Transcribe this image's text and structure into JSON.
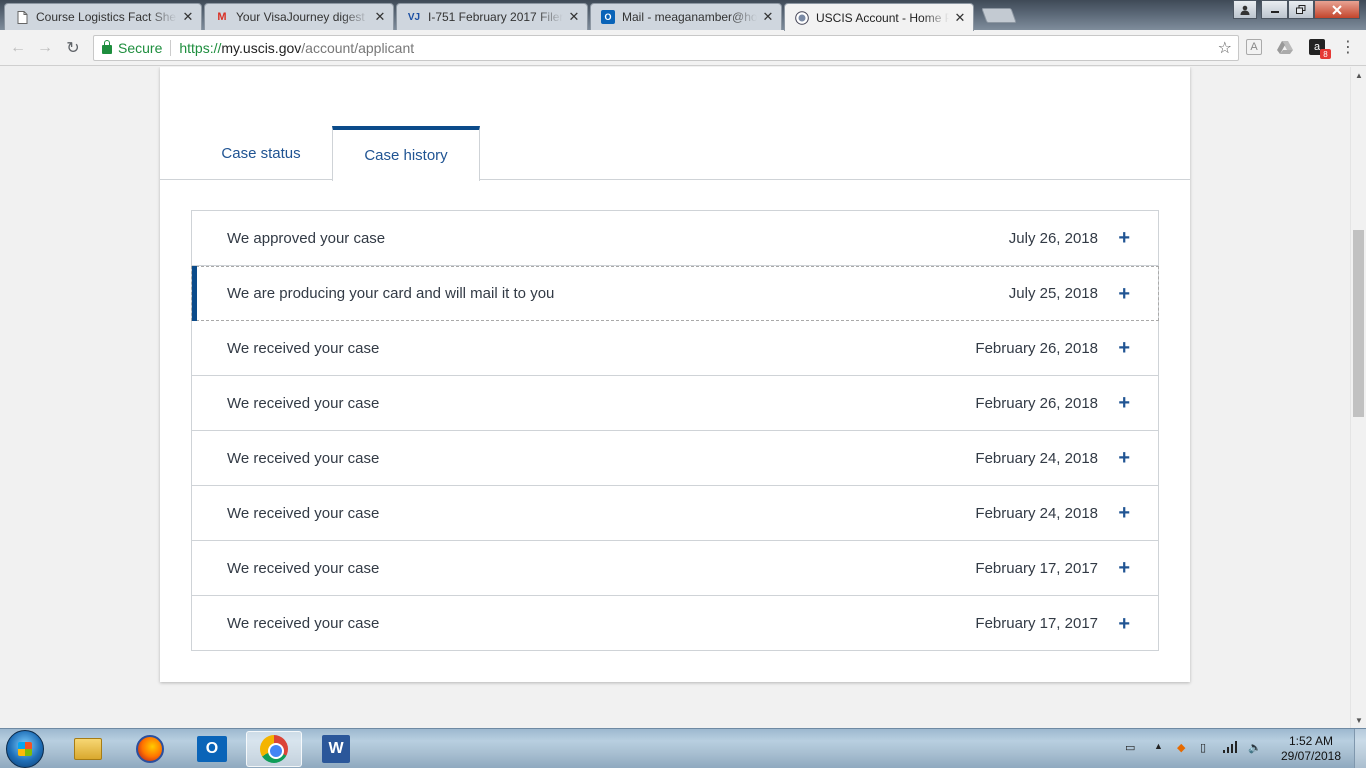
{
  "browser": {
    "tabs": [
      {
        "title": "Course Logistics Fact She",
        "favicon": "document-icon",
        "active": false
      },
      {
        "title": "Your VisaJourney digest -",
        "favicon": "gmail-icon",
        "active": false
      },
      {
        "title": "I-751 February 2017 Filer",
        "favicon": "visajourney-icon",
        "active": false
      },
      {
        "title": "Mail - meaganamber@ho",
        "favicon": "outlook-icon",
        "active": false
      },
      {
        "title": "USCIS Account - Home P",
        "favicon": "uscis-seal-icon",
        "active": true
      }
    ],
    "secure_label": "Secure",
    "url_scheme": "https://",
    "url_host": "my.uscis.gov",
    "url_path": "/account/applicant",
    "extension_badge": "8"
  },
  "page": {
    "case_tabs": [
      {
        "label": "Case status",
        "active": false
      },
      {
        "label": "Case history",
        "active": true
      }
    ],
    "history": [
      {
        "description": "We approved your case",
        "date": "July 26, 2018"
      },
      {
        "description": "We are producing your card and will mail it to you",
        "date": "July 25, 2018"
      },
      {
        "description": "We received your case",
        "date": "February 26, 2018"
      },
      {
        "description": "We received your case",
        "date": "February 26, 2018"
      },
      {
        "description": "We received your case",
        "date": "February 24, 2018"
      },
      {
        "description": "We received your case",
        "date": "February 24, 2018"
      },
      {
        "description": "We received your case",
        "date": "February 17, 2017"
      },
      {
        "description": "We received your case",
        "date": "February 17, 2017"
      }
    ],
    "expand_symbol": "+"
  },
  "taskbar": {
    "apps": [
      "file-explorer-icon",
      "firefox-icon",
      "outlook-icon",
      "chrome-icon",
      "word-icon"
    ],
    "active_app": "chrome-icon",
    "clock_time": "1:52 AM",
    "clock_date": "29/07/2018"
  },
  "colors": {
    "link_blue": "#205493",
    "accent_navy": "#0b4b8a",
    "secure_green": "#1e8e3e"
  }
}
